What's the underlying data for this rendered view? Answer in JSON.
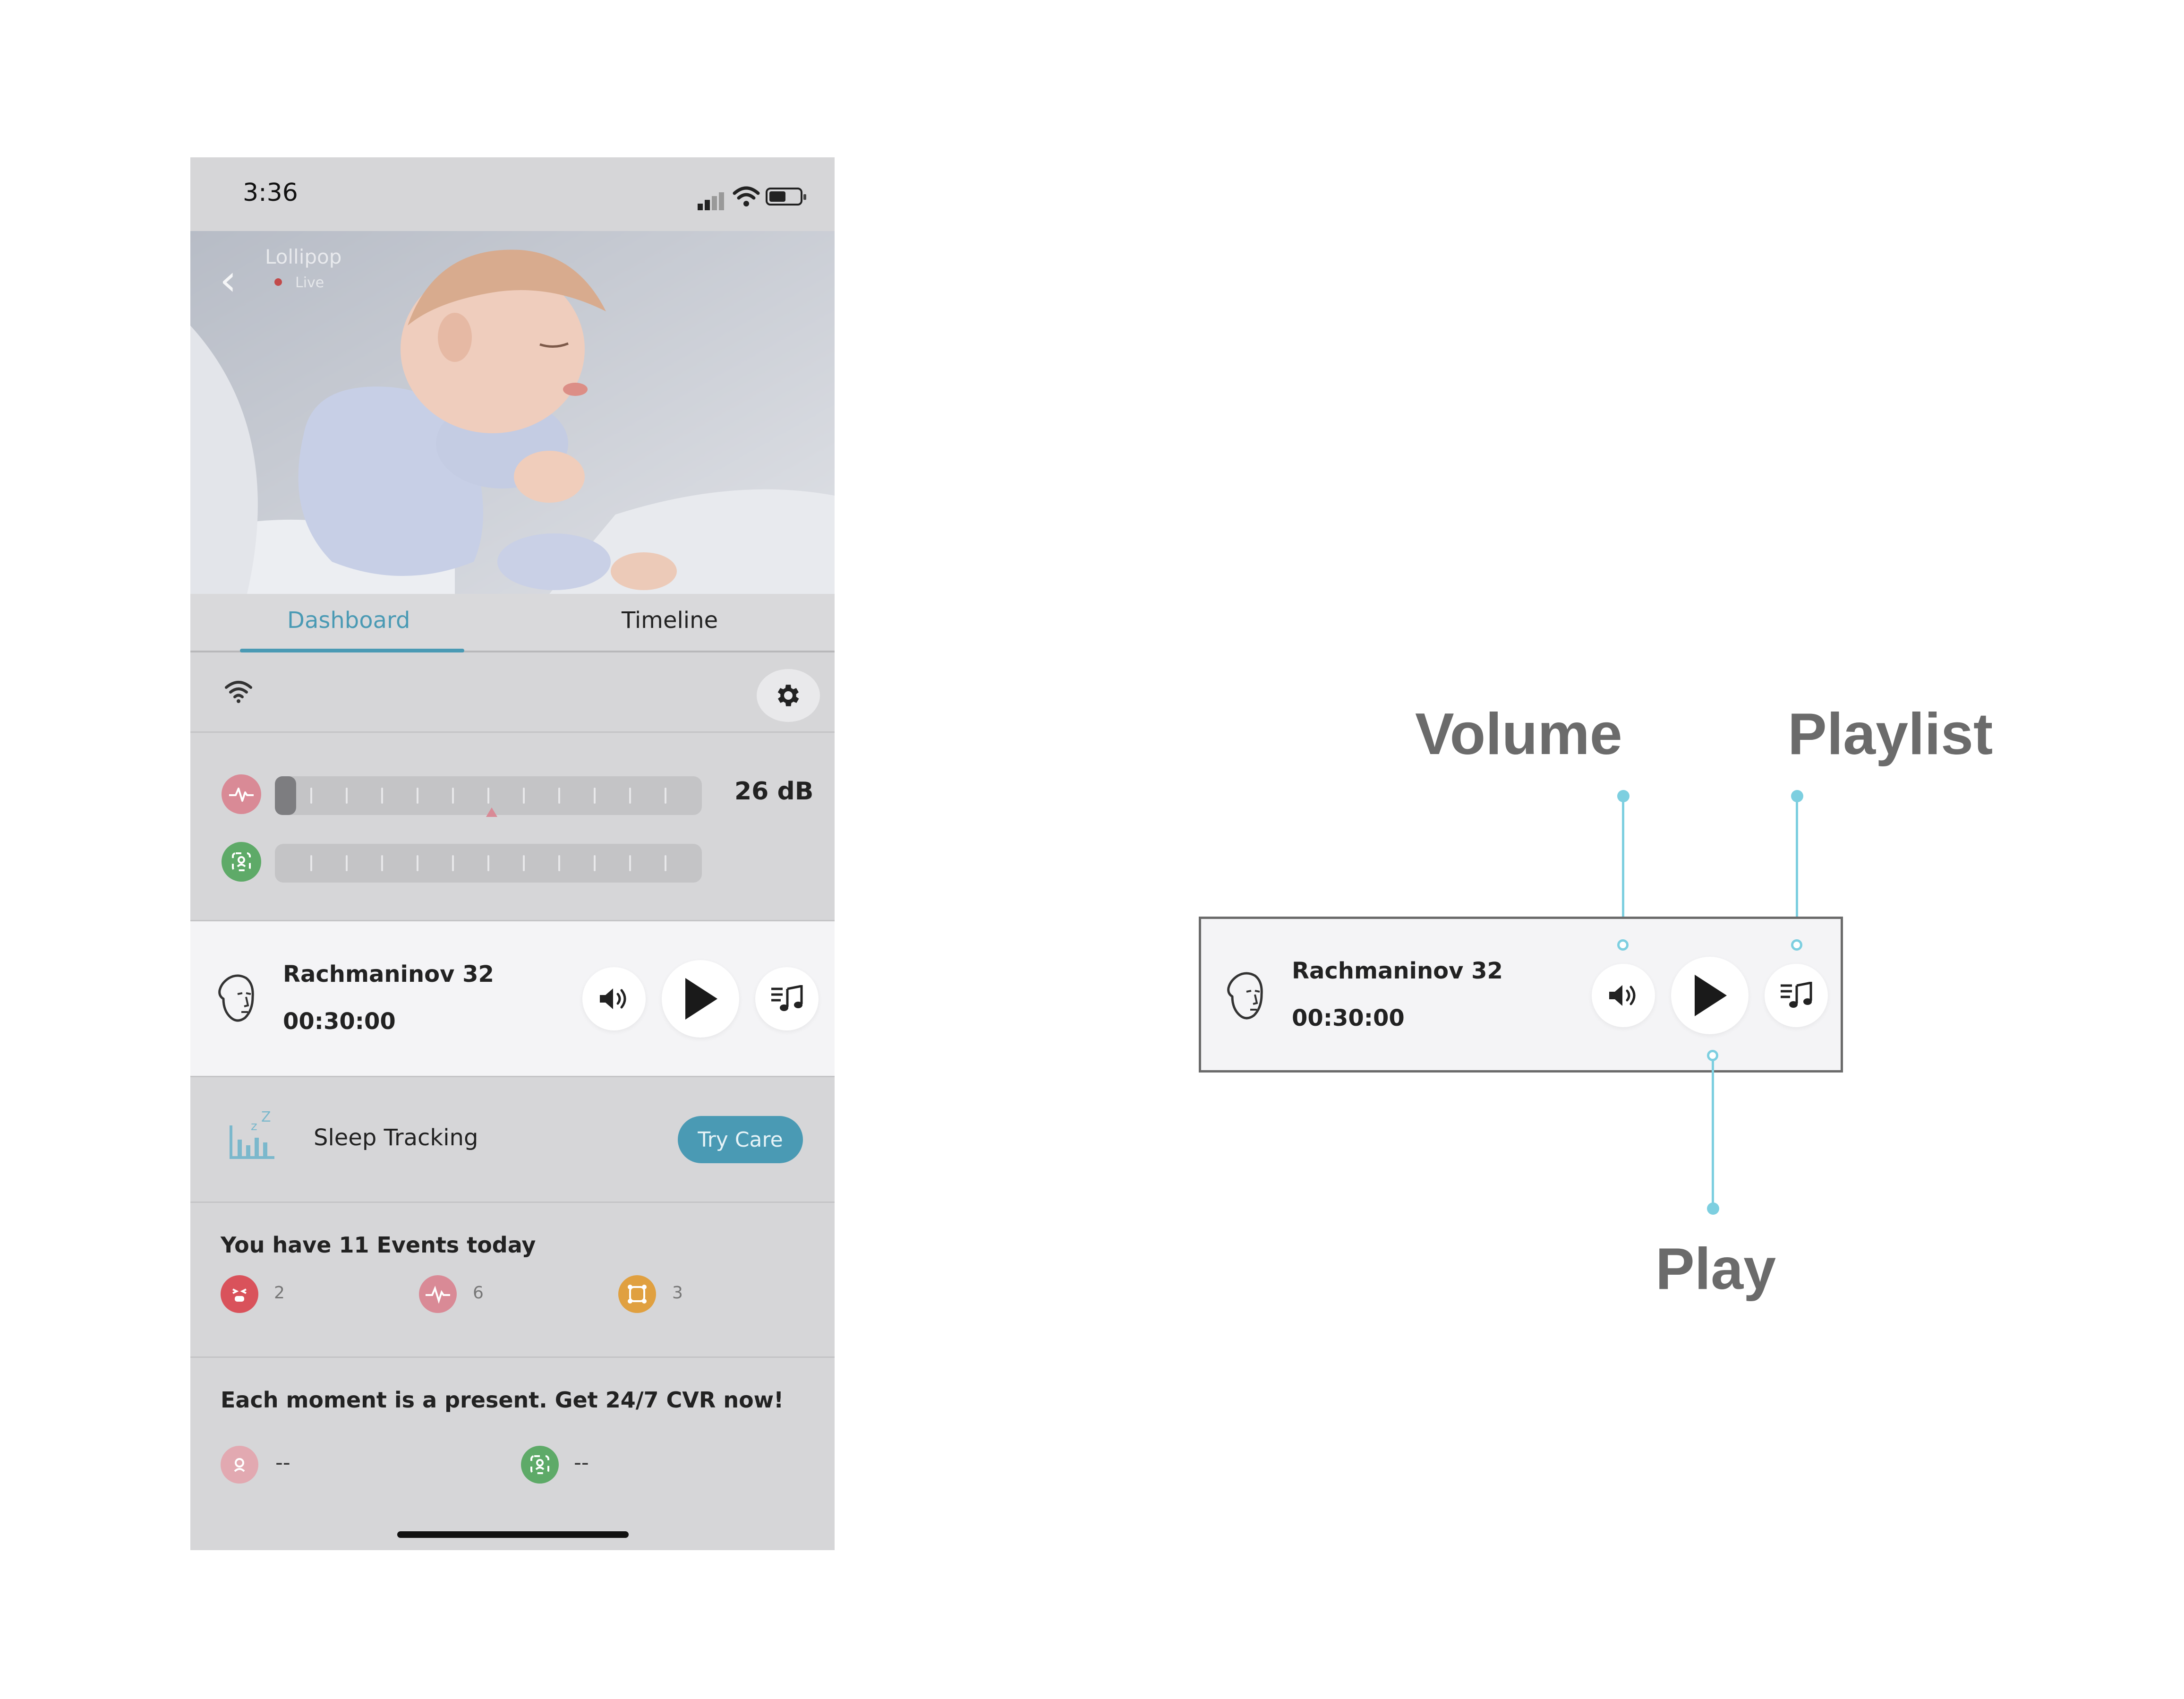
{
  "status_bar": {
    "time": "3:36"
  },
  "camera": {
    "name": "Lollipop",
    "live_label": "Live"
  },
  "tabs": {
    "dashboard": "Dashboard",
    "timeline": "Timeline"
  },
  "meters": {
    "sound_level": "26 dB",
    "sound_fill_fraction": 0.05
  },
  "player": {
    "track": "Rachmaninov 32",
    "duration": "00:30:00"
  },
  "sleep": {
    "label": "Sleep Tracking",
    "cta": "Try Care"
  },
  "events": {
    "title": "You have 11 Events today",
    "items": [
      {
        "icon": "crying-face-icon",
        "count": "2",
        "color": "#d9525b"
      },
      {
        "icon": "sound-wave-icon",
        "count": "6",
        "color": "#d98a96"
      },
      {
        "icon": "face-cover-icon",
        "count": "3",
        "color": "#e0a040"
      }
    ]
  },
  "cvr": {
    "title": "Each moment is a present. Get 24/7 CVR now!",
    "items": [
      {
        "icon": "pink-status-icon",
        "value": "--",
        "color": "#d98a96"
      },
      {
        "icon": "green-status-icon",
        "value": "--",
        "color": "#5eaa68"
      }
    ]
  },
  "annotation": {
    "player": {
      "track": "Rachmaninov 32",
      "duration": "00:30:00"
    },
    "labels": {
      "volume": "Volume",
      "playlist": "Playlist",
      "play": "Play"
    }
  },
  "colors": {
    "accent": "#4a9ab4",
    "callout_line": "#7dcfe0",
    "callout_text": "#6b6b6b"
  }
}
